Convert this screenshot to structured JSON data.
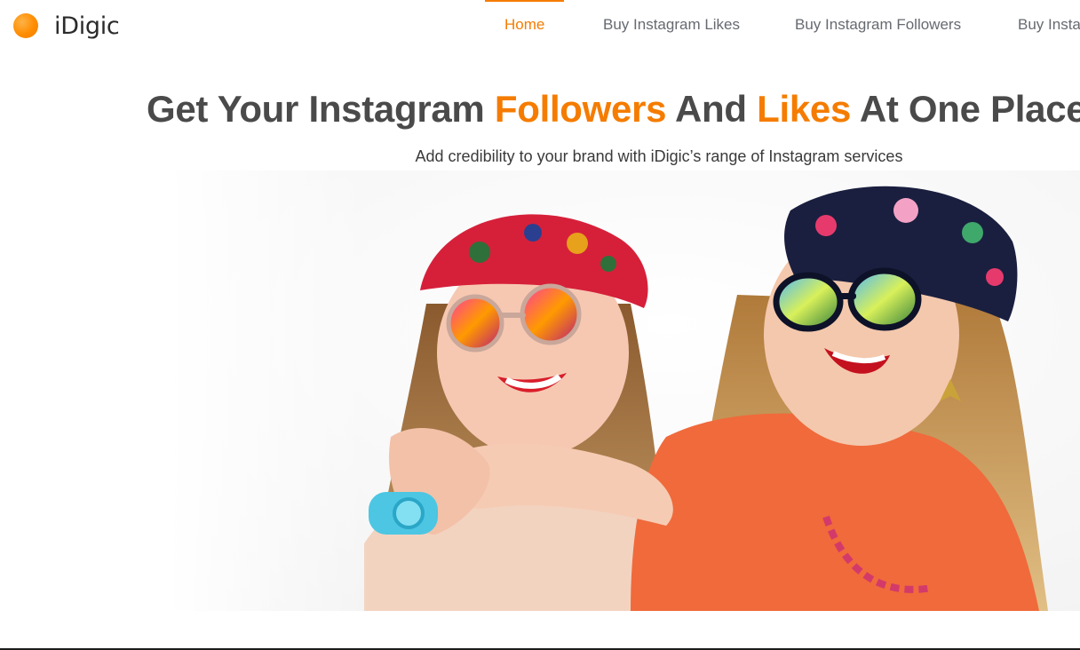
{
  "brand": {
    "logo_icon": "orange-dot-icon",
    "name": "iDigic",
    "accent_color": "#f57c00"
  },
  "nav": {
    "items": [
      {
        "label": "Home",
        "active": true
      },
      {
        "label": "Buy Instagram Likes",
        "active": false
      },
      {
        "label": "Buy Instagram Followers",
        "active": false
      },
      {
        "label": "Buy Insta",
        "active": false
      }
    ]
  },
  "hero": {
    "headline_parts": [
      "Get Your Instagram ",
      "Followers",
      " And ",
      "Likes",
      " At One Place, Inst"
    ],
    "subheading": "Add credibility to your brand with iDigic’s range of Instagram services",
    "image_icon": "two-women-photo-icon"
  }
}
